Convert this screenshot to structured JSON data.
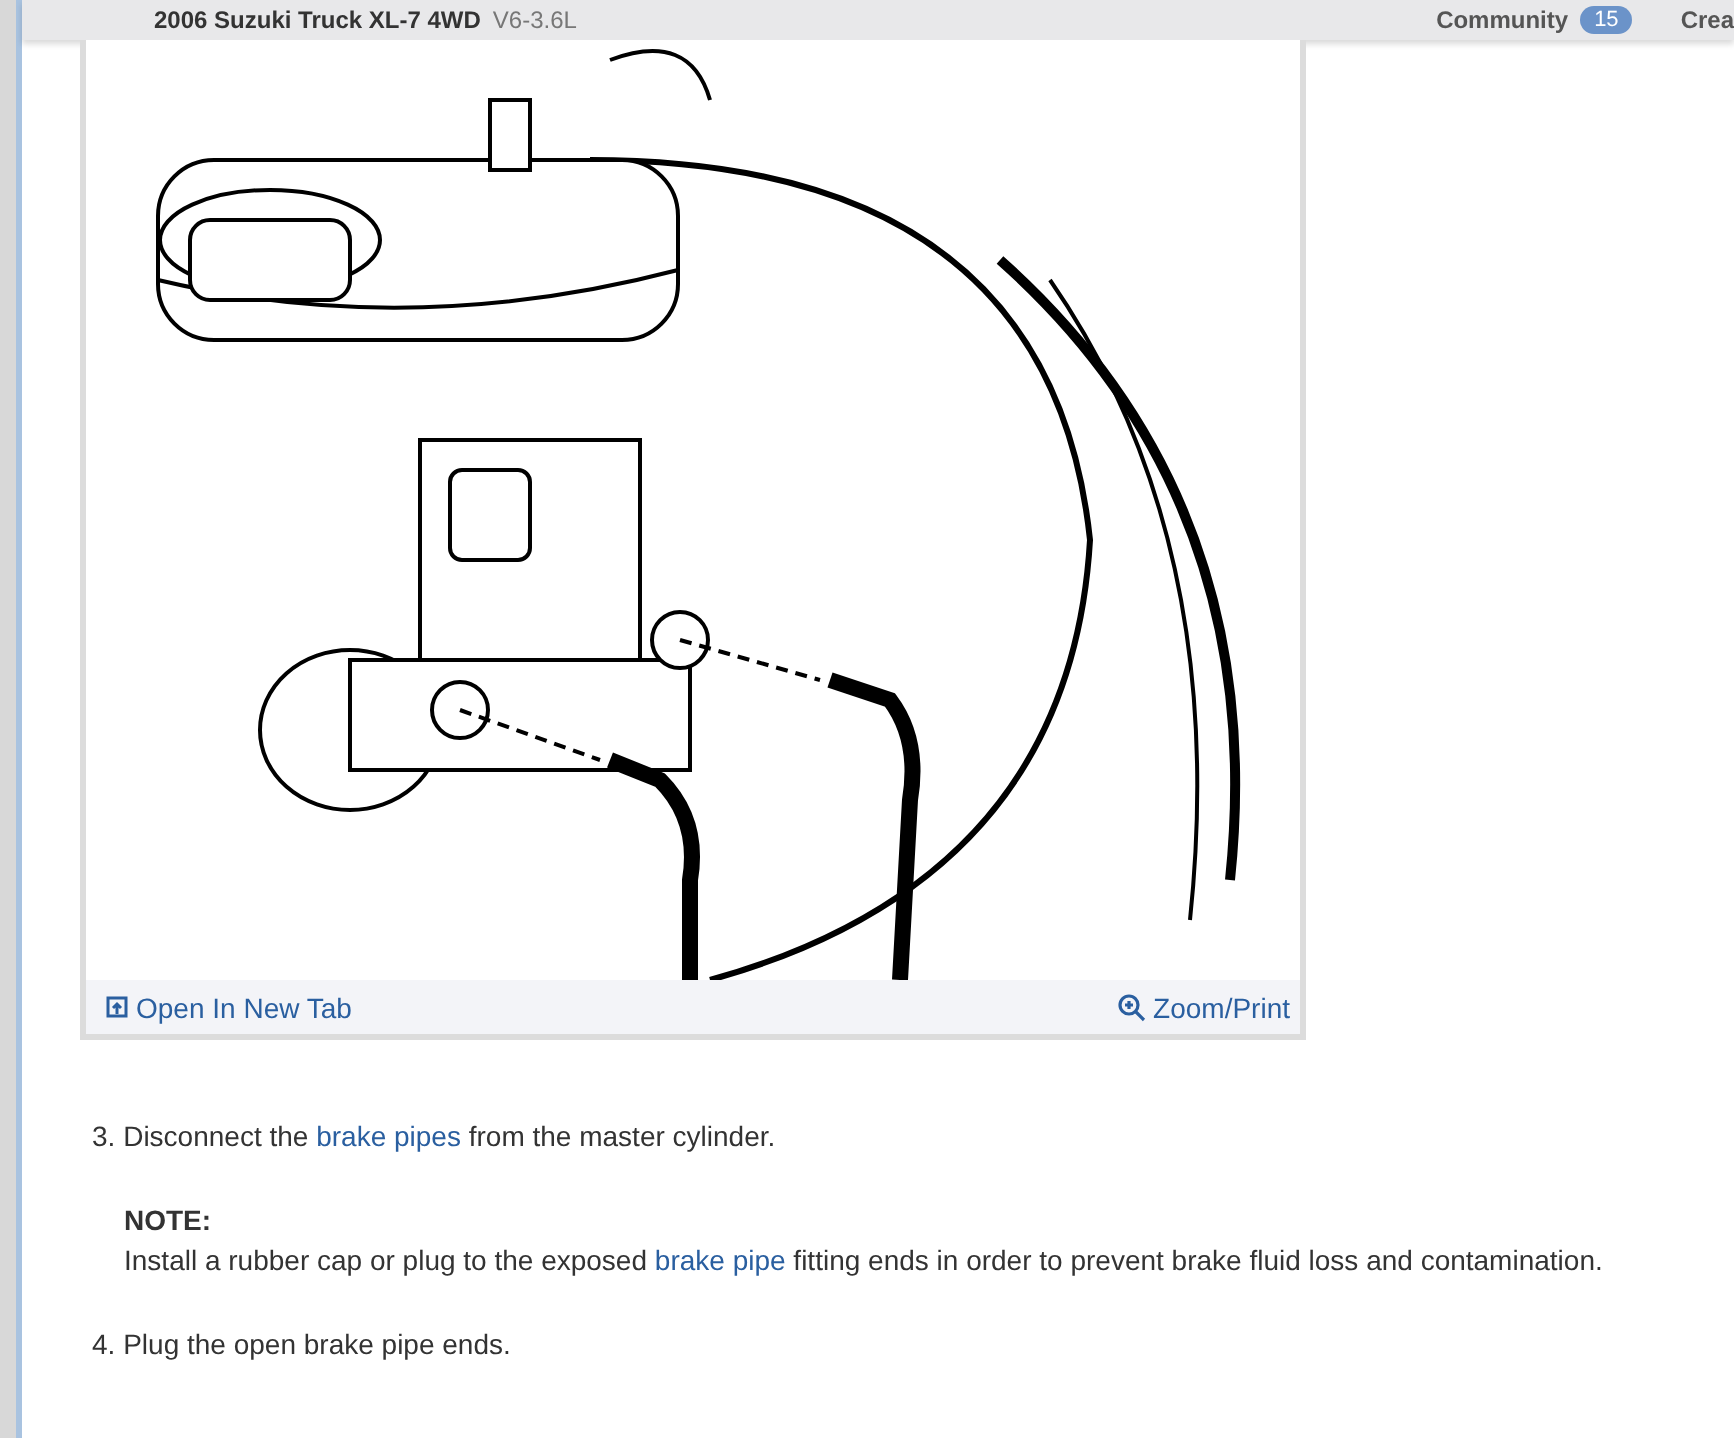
{
  "header": {
    "title": "2006 Suzuki Truck XL-7 4WD",
    "engine": "V6-3.6L",
    "community": "Community",
    "community_count": "15",
    "create": "Crea"
  },
  "figure": {
    "open_link": "Open In New Tab",
    "zoom_link": "Zoom/Print"
  },
  "steps": [
    {
      "kind": "step",
      "number": "3.",
      "parts": [
        {
          "text": "Disconnect the "
        },
        {
          "text": "brake pipes",
          "link": true
        },
        {
          "text": " from the master cylinder."
        }
      ]
    },
    {
      "kind": "note",
      "label": "NOTE:",
      "parts": [
        {
          "text": "Install a rubber cap or plug to the exposed "
        },
        {
          "text": "brake pipe",
          "link": true
        },
        {
          "text": " fitting ends in order to prevent brake fluid loss and contamination."
        }
      ]
    },
    {
      "kind": "step",
      "number": "4.",
      "parts": [
        {
          "text": "Plug the open brake pipe ends."
        }
      ]
    }
  ]
}
